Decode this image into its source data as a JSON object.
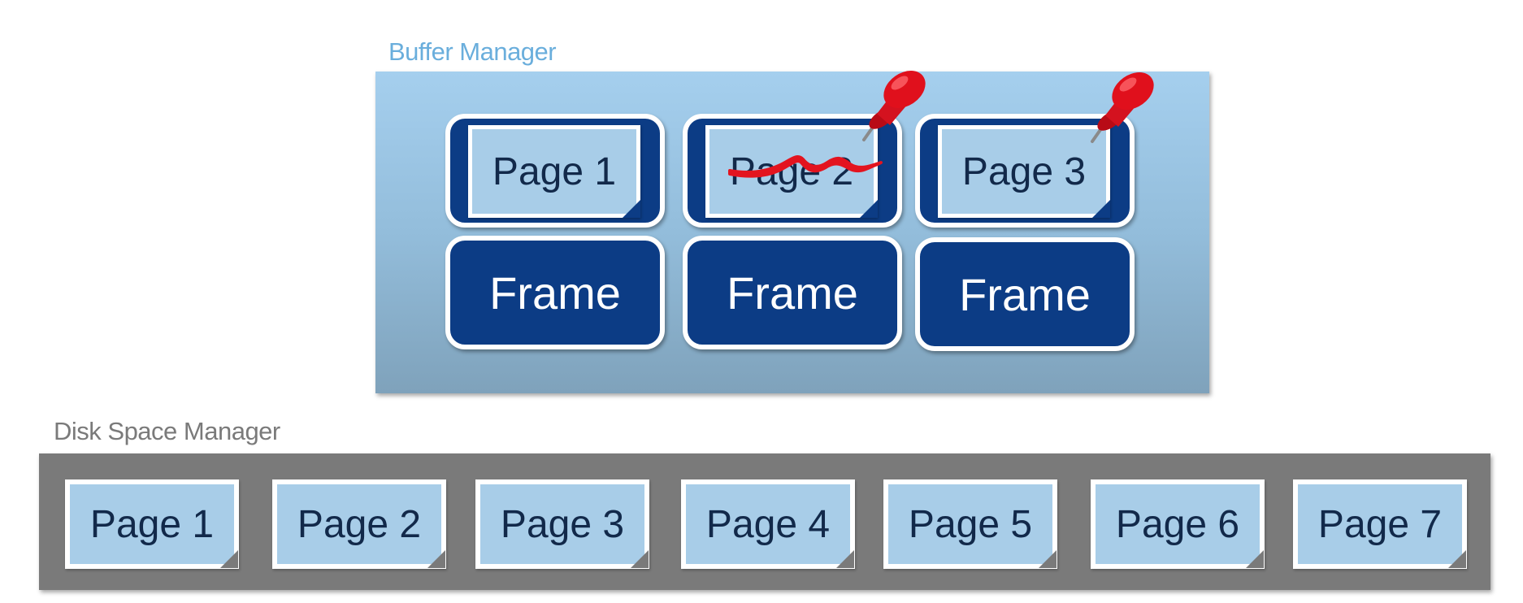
{
  "buffer_manager": {
    "label": "Buffer Manager",
    "label_color": "#6aaedc",
    "frames": [
      {
        "page_label": "Page 1",
        "frame_label": "Frame",
        "pinned": false,
        "crossed_out": false
      },
      {
        "page_label": "Page 2",
        "frame_label": "Frame",
        "pinned": true,
        "crossed_out": true
      },
      {
        "page_label": "Page 3",
        "frame_label": "Frame",
        "pinned": true,
        "crossed_out": false
      }
    ]
  },
  "disk_space_manager": {
    "label": "Disk Space Manager",
    "label_color": "#7a7a7a",
    "pages": [
      "Page 1",
      "Page 2",
      "Page 3",
      "Page 4",
      "Page 5",
      "Page 6",
      "Page 7"
    ]
  },
  "colors": {
    "frame_fill": "#0c3c85",
    "page_fill": "#a8cde8",
    "page_text": "#12294a",
    "disk_fill": "#7a7a7a",
    "pin_red": "#e0101c",
    "strike_red": "#e3141f"
  },
  "icons": {
    "pin": "pushpin-icon"
  }
}
